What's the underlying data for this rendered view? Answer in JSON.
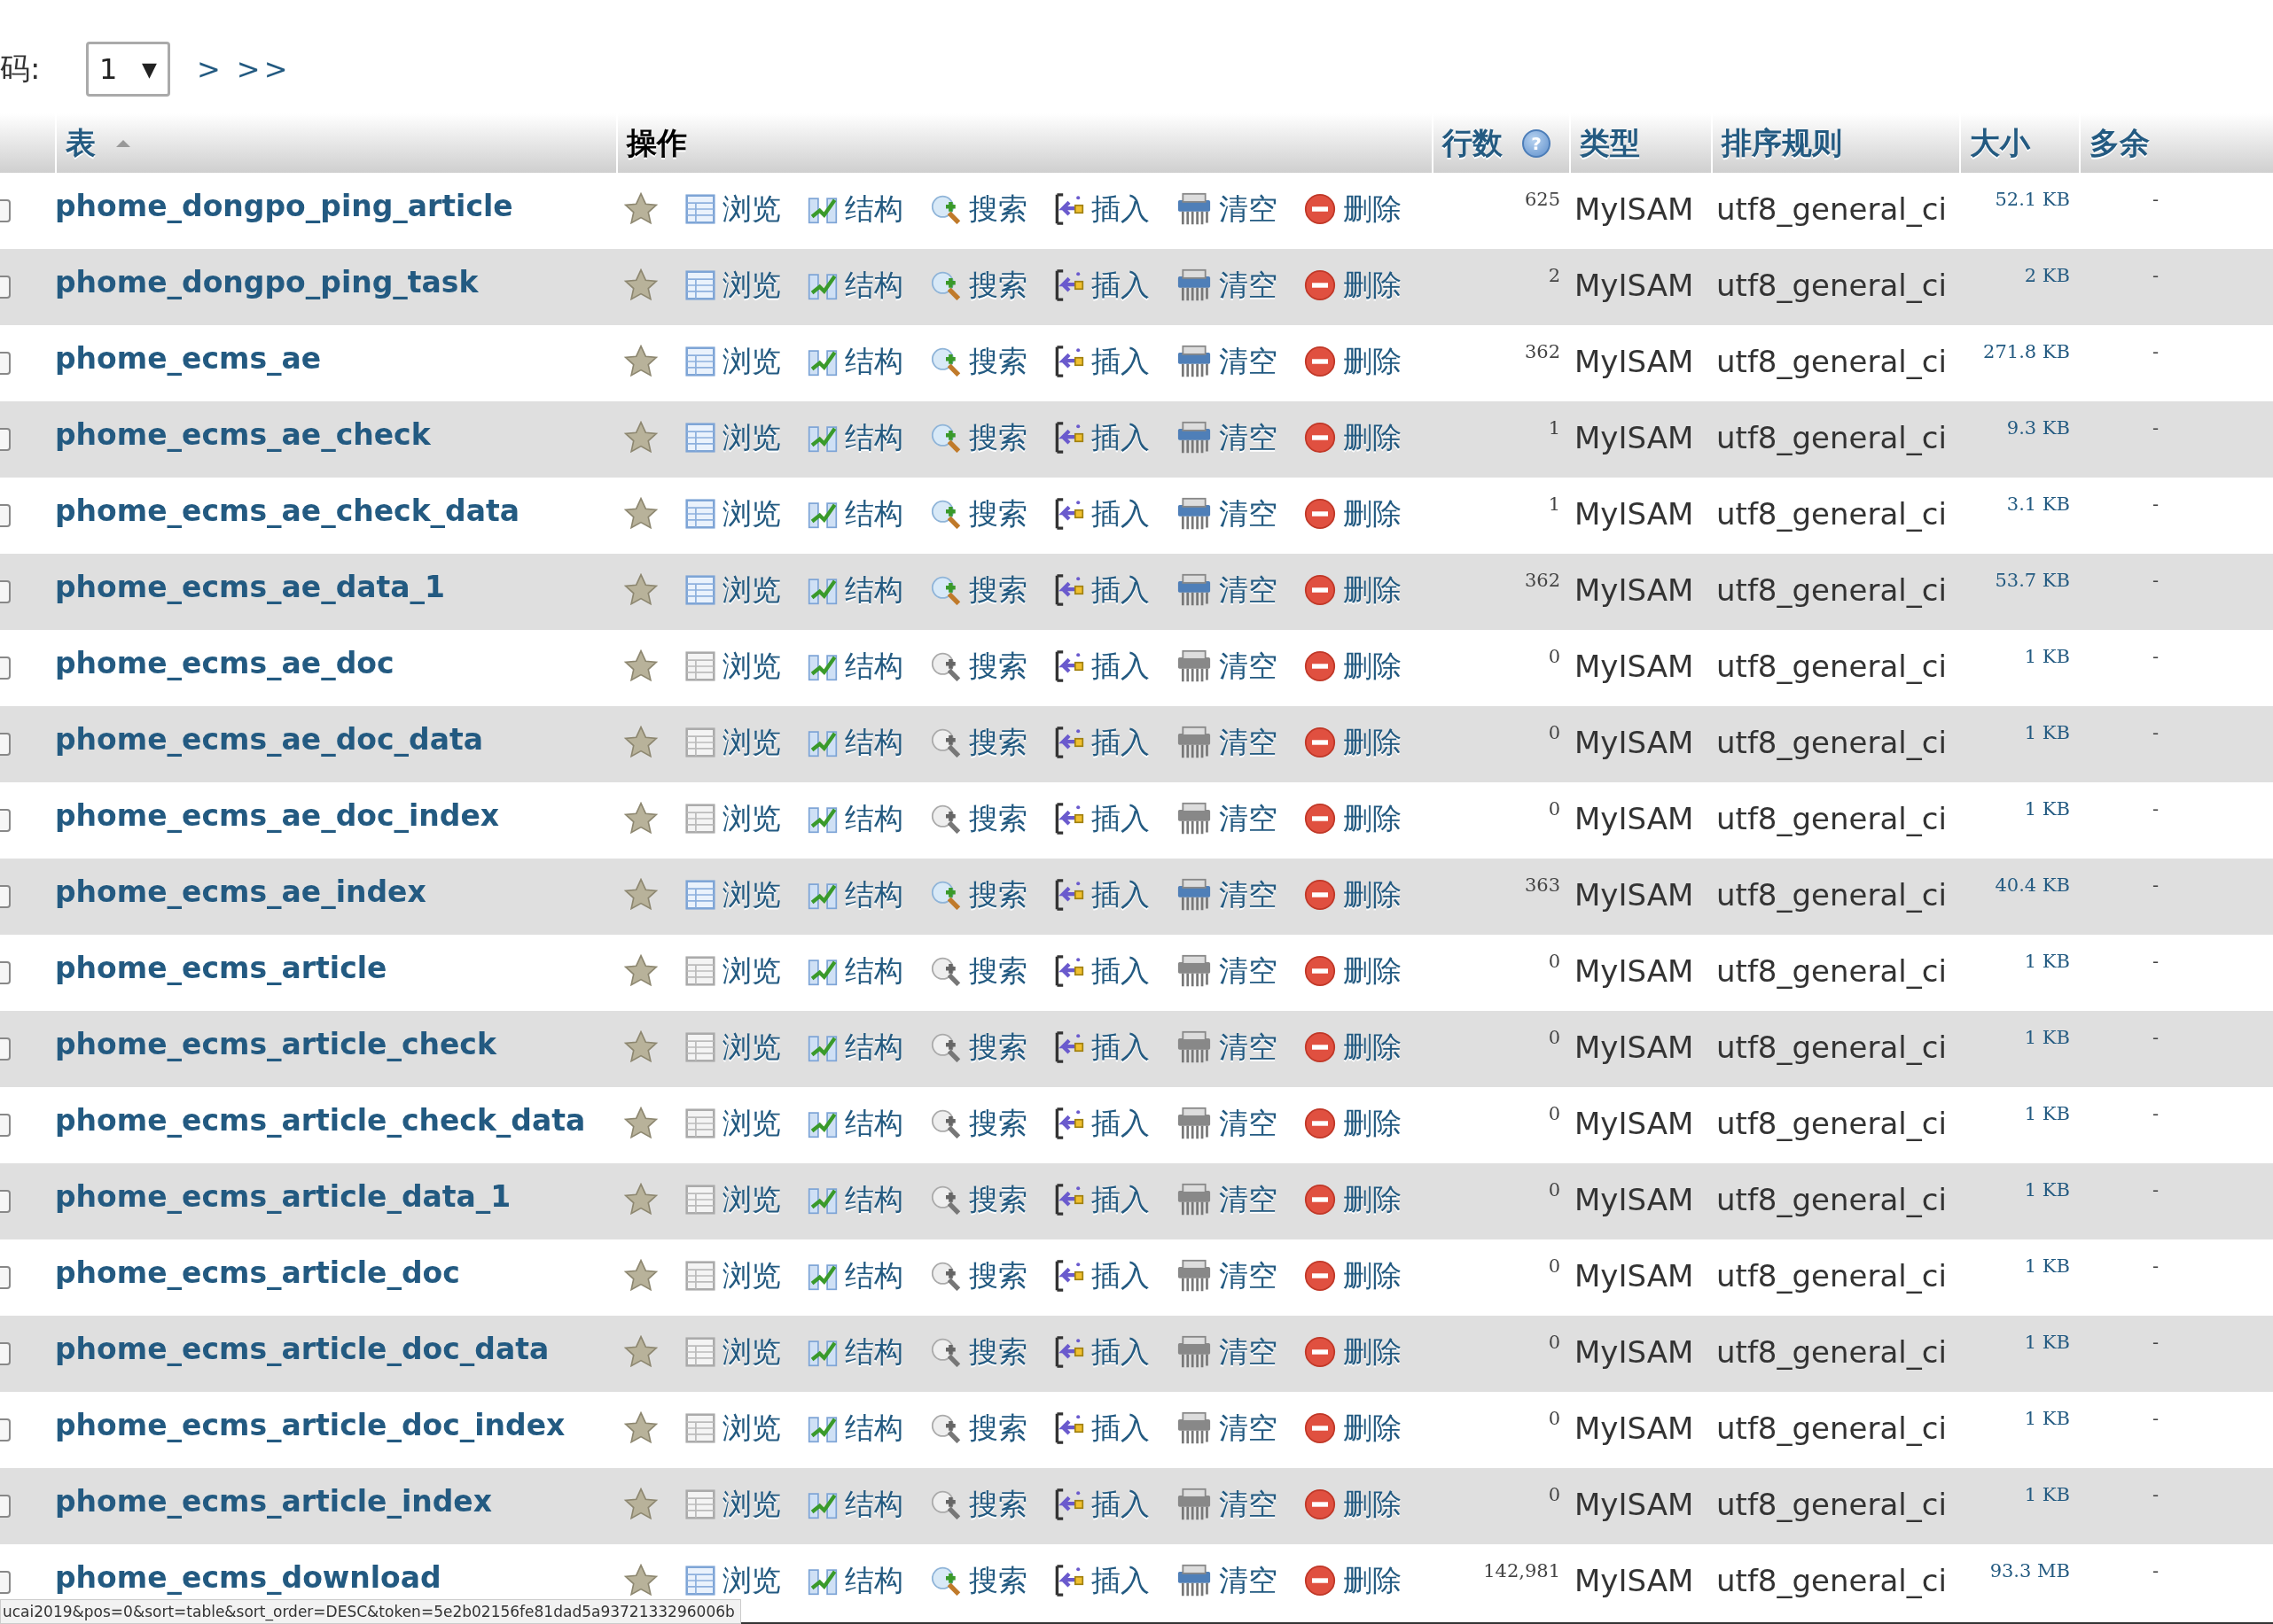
{
  "pagination": {
    "label": "码:",
    "page_select": "1",
    "select_caret": "▼",
    "next": ">",
    "last": ">>"
  },
  "table": {
    "columns": [
      {
        "label": "表",
        "sortable": true,
        "sorted": true
      },
      {
        "label": "操作",
        "sortable": false,
        "sorted": false
      },
      {
        "label": "行数",
        "sortable": true,
        "sorted": false,
        "help_icon": "?"
      },
      {
        "label": "类型",
        "sortable": true,
        "sorted": false
      },
      {
        "label": "排序规则",
        "sortable": true,
        "sorted": false
      },
      {
        "label": "大小",
        "sortable": true,
        "sorted": false
      },
      {
        "label": "多余",
        "sortable": true,
        "sorted": false
      }
    ],
    "rows": [
      {
        "name": "phome_dongpo_ping_article",
        "checked": false,
        "empty": false,
        "actions": {
          "browse": "浏览",
          "structure": "结构",
          "search": "搜索",
          "insert": "插入",
          "empty": "清空",
          "drop": "删除"
        },
        "rows": "625",
        "type": "MyISAM",
        "collation": "utf8_general_ci",
        "size": "52.1 KB",
        "overhead": "-"
      },
      {
        "name": "phome_dongpo_ping_task",
        "checked": false,
        "empty": false,
        "actions": {
          "browse": "浏览",
          "structure": "结构",
          "search": "搜索",
          "insert": "插入",
          "empty": "清空",
          "drop": "删除"
        },
        "rows": "2",
        "type": "MyISAM",
        "collation": "utf8_general_ci",
        "size": "2 KB",
        "overhead": "-"
      },
      {
        "name": "phome_ecms_ae",
        "checked": false,
        "empty": false,
        "actions": {
          "browse": "浏览",
          "structure": "结构",
          "search": "搜索",
          "insert": "插入",
          "empty": "清空",
          "drop": "删除"
        },
        "rows": "362",
        "type": "MyISAM",
        "collation": "utf8_general_ci",
        "size": "271.8 KB",
        "overhead": "-"
      },
      {
        "name": "phome_ecms_ae_check",
        "checked": false,
        "empty": false,
        "actions": {
          "browse": "浏览",
          "structure": "结构",
          "search": "搜索",
          "insert": "插入",
          "empty": "清空",
          "drop": "删除"
        },
        "rows": "1",
        "type": "MyISAM",
        "collation": "utf8_general_ci",
        "size": "9.3 KB",
        "overhead": "-"
      },
      {
        "name": "phome_ecms_ae_check_data",
        "checked": false,
        "empty": false,
        "actions": {
          "browse": "浏览",
          "structure": "结构",
          "search": "搜索",
          "insert": "插入",
          "empty": "清空",
          "drop": "删除"
        },
        "rows": "1",
        "type": "MyISAM",
        "collation": "utf8_general_ci",
        "size": "3.1 KB",
        "overhead": "-"
      },
      {
        "name": "phome_ecms_ae_data_1",
        "checked": false,
        "empty": false,
        "actions": {
          "browse": "浏览",
          "structure": "结构",
          "search": "搜索",
          "insert": "插入",
          "empty": "清空",
          "drop": "删除"
        },
        "rows": "362",
        "type": "MyISAM",
        "collation": "utf8_general_ci",
        "size": "53.7 KB",
        "overhead": "-"
      },
      {
        "name": "phome_ecms_ae_doc",
        "checked": false,
        "empty": true,
        "actions": {
          "browse": "浏览",
          "structure": "结构",
          "search": "搜索",
          "insert": "插入",
          "empty": "清空",
          "drop": "删除"
        },
        "rows": "0",
        "type": "MyISAM",
        "collation": "utf8_general_ci",
        "size": "1 KB",
        "overhead": "-"
      },
      {
        "name": "phome_ecms_ae_doc_data",
        "checked": false,
        "empty": true,
        "actions": {
          "browse": "浏览",
          "structure": "结构",
          "search": "搜索",
          "insert": "插入",
          "empty": "清空",
          "drop": "删除"
        },
        "rows": "0",
        "type": "MyISAM",
        "collation": "utf8_general_ci",
        "size": "1 KB",
        "overhead": "-"
      },
      {
        "name": "phome_ecms_ae_doc_index",
        "checked": false,
        "empty": true,
        "actions": {
          "browse": "浏览",
          "structure": "结构",
          "search": "搜索",
          "insert": "插入",
          "empty": "清空",
          "drop": "删除"
        },
        "rows": "0",
        "type": "MyISAM",
        "collation": "utf8_general_ci",
        "size": "1 KB",
        "overhead": "-"
      },
      {
        "name": "phome_ecms_ae_index",
        "checked": false,
        "empty": false,
        "actions": {
          "browse": "浏览",
          "structure": "结构",
          "search": "搜索",
          "insert": "插入",
          "empty": "清空",
          "drop": "删除"
        },
        "rows": "363",
        "type": "MyISAM",
        "collation": "utf8_general_ci",
        "size": "40.4 KB",
        "overhead": "-"
      },
      {
        "name": "phome_ecms_article",
        "checked": false,
        "empty": true,
        "actions": {
          "browse": "浏览",
          "structure": "结构",
          "search": "搜索",
          "insert": "插入",
          "empty": "清空",
          "drop": "删除"
        },
        "rows": "0",
        "type": "MyISAM",
        "collation": "utf8_general_ci",
        "size": "1 KB",
        "overhead": "-"
      },
      {
        "name": "phome_ecms_article_check",
        "checked": false,
        "empty": true,
        "actions": {
          "browse": "浏览",
          "structure": "结构",
          "search": "搜索",
          "insert": "插入",
          "empty": "清空",
          "drop": "删除"
        },
        "rows": "0",
        "type": "MyISAM",
        "collation": "utf8_general_ci",
        "size": "1 KB",
        "overhead": "-"
      },
      {
        "name": "phome_ecms_article_check_data",
        "checked": false,
        "empty": true,
        "actions": {
          "browse": "浏览",
          "structure": "结构",
          "search": "搜索",
          "insert": "插入",
          "empty": "清空",
          "drop": "删除"
        },
        "rows": "0",
        "type": "MyISAM",
        "collation": "utf8_general_ci",
        "size": "1 KB",
        "overhead": "-"
      },
      {
        "name": "phome_ecms_article_data_1",
        "checked": false,
        "empty": true,
        "actions": {
          "browse": "浏览",
          "structure": "结构",
          "search": "搜索",
          "insert": "插入",
          "empty": "清空",
          "drop": "删除"
        },
        "rows": "0",
        "type": "MyISAM",
        "collation": "utf8_general_ci",
        "size": "1 KB",
        "overhead": "-"
      },
      {
        "name": "phome_ecms_article_doc",
        "checked": false,
        "empty": true,
        "actions": {
          "browse": "浏览",
          "structure": "结构",
          "search": "搜索",
          "insert": "插入",
          "empty": "清空",
          "drop": "删除"
        },
        "rows": "0",
        "type": "MyISAM",
        "collation": "utf8_general_ci",
        "size": "1 KB",
        "overhead": "-"
      },
      {
        "name": "phome_ecms_article_doc_data",
        "checked": false,
        "empty": true,
        "actions": {
          "browse": "浏览",
          "structure": "结构",
          "search": "搜索",
          "insert": "插入",
          "empty": "清空",
          "drop": "删除"
        },
        "rows": "0",
        "type": "MyISAM",
        "collation": "utf8_general_ci",
        "size": "1 KB",
        "overhead": "-"
      },
      {
        "name": "phome_ecms_article_doc_index",
        "checked": false,
        "empty": true,
        "actions": {
          "browse": "浏览",
          "structure": "结构",
          "search": "搜索",
          "insert": "插入",
          "empty": "清空",
          "drop": "删除"
        },
        "rows": "0",
        "type": "MyISAM",
        "collation": "utf8_general_ci",
        "size": "1 KB",
        "overhead": "-"
      },
      {
        "name": "phome_ecms_article_index",
        "checked": false,
        "empty": true,
        "actions": {
          "browse": "浏览",
          "structure": "结构",
          "search": "搜索",
          "insert": "插入",
          "empty": "清空",
          "drop": "删除"
        },
        "rows": "0",
        "type": "MyISAM",
        "collation": "utf8_general_ci",
        "size": "1 KB",
        "overhead": "-"
      },
      {
        "name": "phome_ecms_download",
        "checked": false,
        "empty": false,
        "actions": {
          "browse": "浏览",
          "structure": "结构",
          "search": "搜索",
          "insert": "插入",
          "empty": "清空",
          "drop": "删除"
        },
        "rows": "142,981",
        "type": "MyISAM",
        "collation": "utf8_general_ci",
        "size": "93.3 MB",
        "overhead": "-"
      }
    ]
  },
  "status_bar": {
    "url": "ucai2019&pos=0&sort=table&sort_order=DESC&token=5e2b02156fe81dad5a9372133296006b"
  }
}
